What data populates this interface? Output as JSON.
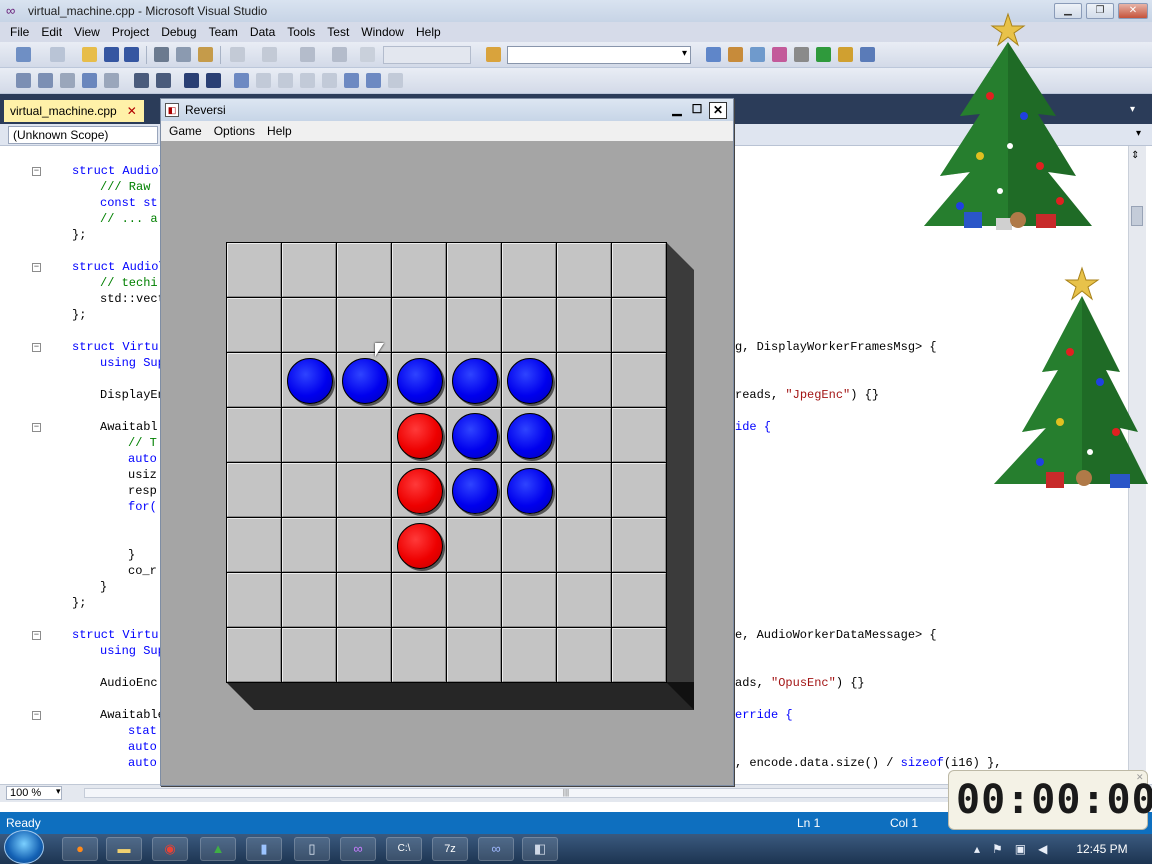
{
  "vs": {
    "window_title": "virtual_machine.cpp - Microsoft Visual Studio",
    "menu": [
      "File",
      "Edit",
      "View",
      "Project",
      "Debug",
      "Team",
      "Data",
      "Tools",
      "Test",
      "Window",
      "Help"
    ],
    "doc_tab": "virtual_machine.cpp",
    "doc_tab_close": "✕",
    "scope": "(Unknown Scope)",
    "zoom": "100 %",
    "status": {
      "left": "Ready",
      "ln": "Ln 1",
      "col": "Col 1"
    }
  },
  "code": {
    "l1": "struct Audio\\",
    "l2": "/// Raw",
    "l3": "const st",
    "l4": "// ... a",
    "l5": "};",
    "l6": "struct Audio\\",
    "l7": "// techi",
    "l8": "std::vect",
    "l9": "};",
    "l10": "struct Virtu",
    "l11": "using Sup",
    "l12": "DisplayEn",
    "l13": "Awaitabl",
    "l14": "// T",
    "l15": "auto",
    "l16": "usiz",
    "l17": "resp",
    "l18": "for(",
    "l19": "}",
    "l20": "co_r",
    "l21": "}",
    "l22": "};",
    "l23": "struct Virtu",
    "l24": "using Sup",
    "l25": "AudioEnc",
    "l26": "Awaitable",
    "l27": "stat",
    "l28": "auto",
    "l29": "auto",
    "r1": "g, DisplayWorkerFramesMsg> {",
    "r2a": "reads, ",
    "r2b": "\"JpegEnc\"",
    "r2c": ") {}",
    "r3": "ide {",
    "r4": "e, AudioWorkerDataMessage> {",
    "r5a": "ads, ",
    "r5b": "\"OpusEnc\"",
    "r5c": ") {}",
    "r6": "erride {",
    "r7a": ", encode.data.size() / ",
    "r7b": "sizeof",
    "r7c": "(i16) },"
  },
  "reversi": {
    "title": "Reversi",
    "menu": [
      "Game",
      "Options",
      "Help"
    ],
    "board": [
      [
        "",
        "",
        "",
        "",
        "",
        "",
        "",
        ""
      ],
      [
        "",
        "",
        "",
        "",
        "",
        "",
        "",
        ""
      ],
      [
        "",
        "blue",
        "blue",
        "blue",
        "blue",
        "blue",
        "",
        ""
      ],
      [
        "",
        "",
        "",
        "red",
        "blue",
        "blue",
        "",
        ""
      ],
      [
        "",
        "",
        "",
        "red",
        "blue",
        "blue",
        "",
        ""
      ],
      [
        "",
        "",
        "",
        "red",
        "",
        "",
        "",
        ""
      ],
      [
        "",
        "",
        "",
        "",
        "",
        "",
        "",
        ""
      ],
      [
        "",
        "",
        "",
        "",
        "",
        "",
        "",
        ""
      ]
    ]
  },
  "timer": {
    "display": "00:00:00"
  },
  "taskbar": {
    "clock": "12:45 PM"
  },
  "colors": {
    "blue_disc": "#0000ee",
    "red_disc": "#ee0000",
    "status_bar": "#0e6fbf"
  }
}
